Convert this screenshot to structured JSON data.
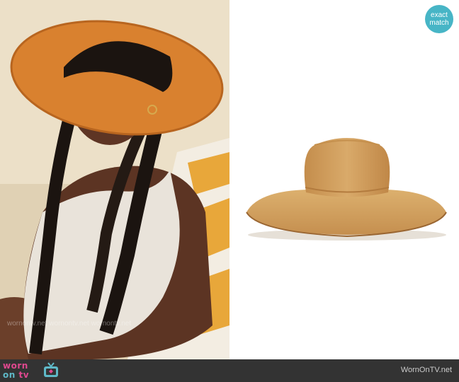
{
  "badge": {
    "line1": "exact",
    "line2": "match"
  },
  "footer": {
    "logo_worn": "worn",
    "logo_on": "on",
    "logo_tv": "tv",
    "site": "WornOnTV.net"
  },
  "colors": {
    "badge": "#47b5c6",
    "footer_bg": "#333333",
    "hat_brim_orange": "#d9812f",
    "straw_hat": "#d5a463",
    "logo_pink": "#e0488f",
    "logo_teal": "#5fb9c8"
  },
  "icons": [
    "tv-icon"
  ]
}
